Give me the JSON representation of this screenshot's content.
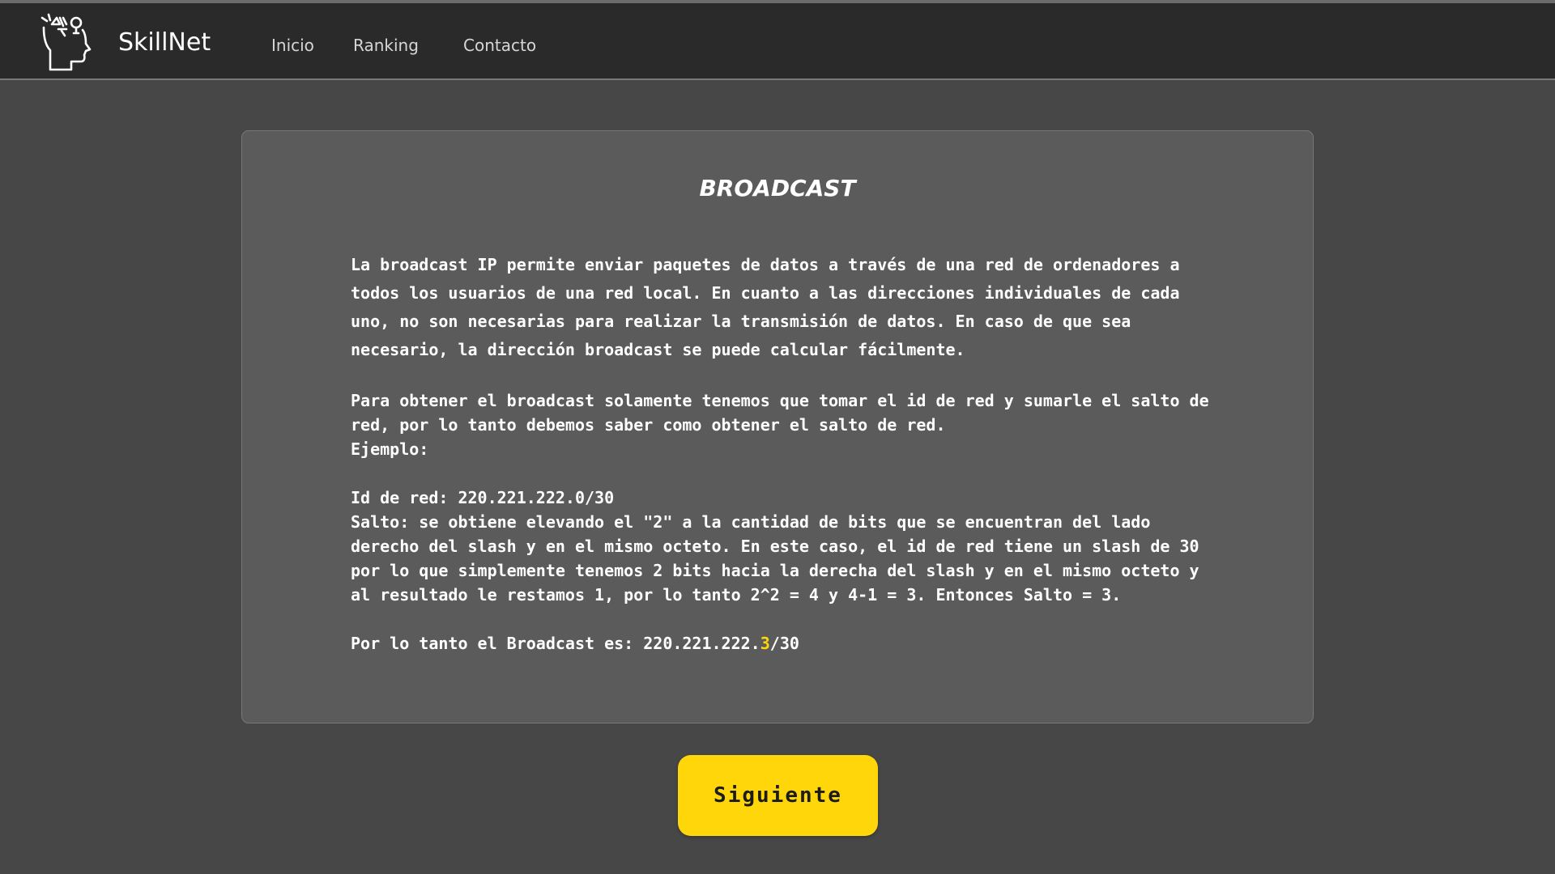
{
  "navbar": {
    "brand": "SkillNet",
    "links": [
      {
        "label": "Inicio"
      },
      {
        "label": "Ranking"
      },
      {
        "label": "Contacto"
      }
    ]
  },
  "card": {
    "title": "BROADCAST",
    "paragraph1": "La broadcast IP permite enviar paquetes de datos a través de una red de ordenadores a todos los usuarios de una red local. En cuanto a las direcciones individuales de cada uno, no son necesarias para realizar la transmisión de datos. En caso de que sea necesario, la dirección broadcast se puede calcular fácilmente.",
    "paragraph2": "Para obtener el broadcast solamente tenemos que tomar el id de red y sumarle el salto de red, por lo tanto debemos saber como obtener el salto de red.\nEjemplo:\n\nId de red: 220.221.222.0/30\nSalto: se obtiene elevando el \"2\" a la cantidad de bits que se encuentran del lado derecho del slash y en el mismo octeto. En este caso, el id de red tiene un slash de 30 por lo que simplemente tenemos 2 bits hacia la derecha del slash y en el mismo octeto y al resultado le restamos 1, por lo tanto 2^2 = 4 y 4-1 = 3. Entonces Salto = 3.\n\n",
    "result_prefix": "Por lo tanto el Broadcast es: 220.221.222.",
    "result_highlight": "3",
    "result_suffix": "/30"
  },
  "next_button": {
    "label": "Siguiente"
  },
  "colors": {
    "background": "#474747",
    "navbar": "#2a2a2a",
    "card": "#5b5b5b",
    "accent": "#ffd60a"
  },
  "icons": {
    "logo": "head-with-ideas-icon"
  }
}
